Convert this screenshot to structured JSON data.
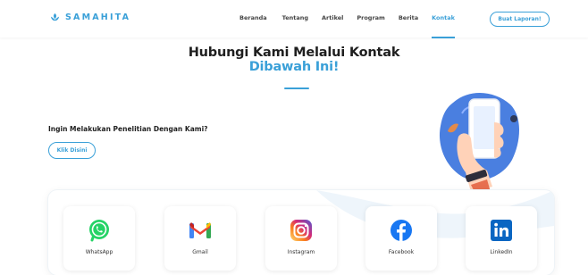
{
  "brand": {
    "name": "SAMAHITA",
    "color": "#3aa0d8"
  },
  "nav": {
    "items": [
      {
        "label": "Beranda"
      },
      {
        "label": "Tentang"
      },
      {
        "label": "Artikel"
      },
      {
        "label": "Program"
      },
      {
        "label": "Berita"
      },
      {
        "label": "Kontak",
        "active": true
      }
    ],
    "cta_label": "Buat Laporan!"
  },
  "hero": {
    "title": "Hubungi Kami Melalui Kontak",
    "subtitle": "Dibawah Ini!"
  },
  "research": {
    "question": "Ingin Melakukan Penelitian Dengan Kami?",
    "button_label": "Klik Disini"
  },
  "contacts": [
    {
      "label": "WhatsApp",
      "icon": "whatsapp-icon",
      "color": "#25d366"
    },
    {
      "label": "Gmail",
      "icon": "gmail-icon",
      "color": "#ea4335"
    },
    {
      "label": "Instagram",
      "icon": "instagram-icon",
      "color": "#c13584"
    },
    {
      "label": "Facebook",
      "icon": "facebook-icon",
      "color": "#1877f2"
    },
    {
      "label": "LinkedIn",
      "icon": "linkedin-icon",
      "color": "#0a66c2"
    }
  ]
}
